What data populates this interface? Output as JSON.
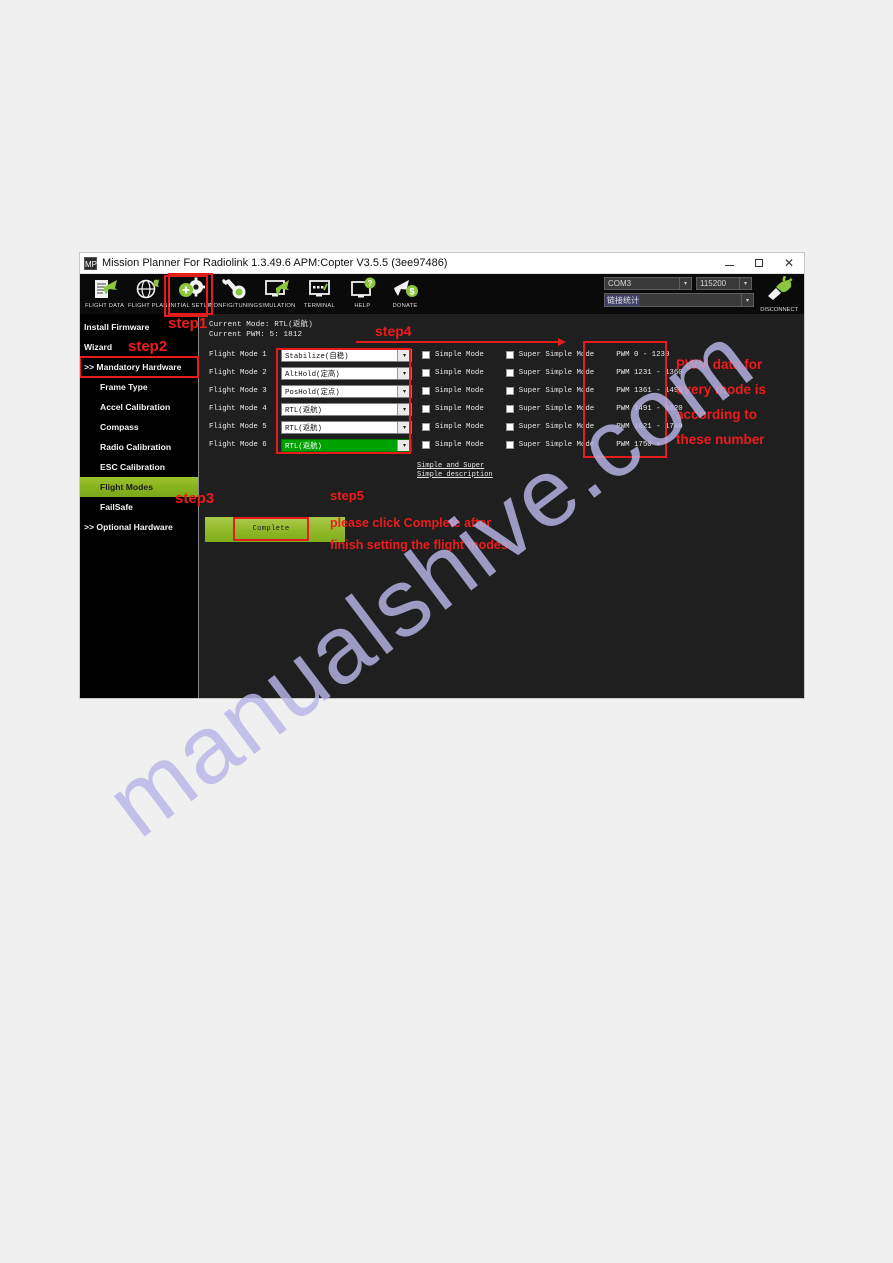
{
  "window": {
    "title": "Mission Planner For Radiolink 1.3.49.6 APM:Copter V3.5.5 (3ee97486)",
    "icon_text": "MP",
    "minimize_label": "–",
    "maximize_label": "❐",
    "close_label": "✕"
  },
  "toolbar": {
    "items": [
      {
        "label": "FLIGHT DATA",
        "icon": "flight-data-icon"
      },
      {
        "label": "FLIGHT PLAN",
        "icon": "flight-plan-icon"
      },
      {
        "label": "INITIAL SETUP",
        "icon": "initial-setup-icon"
      },
      {
        "label": "CONFIG/TUNING",
        "icon": "config-tuning-icon"
      },
      {
        "label": "SIMULATION",
        "icon": "simulation-icon"
      },
      {
        "label": "TERMINAL",
        "icon": "terminal-icon"
      },
      {
        "label": "HELP",
        "icon": "help-icon"
      },
      {
        "label": "DONATE",
        "icon": "donate-icon"
      }
    ],
    "active_index": 2
  },
  "connection": {
    "port": "COM3",
    "baud": "115200",
    "link_label": "链接统计",
    "link_value": "",
    "disconnect_label": "DISCONNECT",
    "dropdown_arrow": "▾"
  },
  "sidebar": {
    "items": [
      {
        "label": "Install Firmware",
        "level": "root",
        "selected": false
      },
      {
        "label": "Wizard",
        "level": "root",
        "selected": false
      },
      {
        "label": ">> Mandatory Hardware",
        "level": "root",
        "selected": false
      },
      {
        "label": "Frame Type",
        "level": "child",
        "selected": false
      },
      {
        "label": "Accel Calibration",
        "level": "child",
        "selected": false
      },
      {
        "label": "Compass",
        "level": "child",
        "selected": false
      },
      {
        "label": "Radio Calibration",
        "level": "child",
        "selected": false
      },
      {
        "label": "ESC Calibration",
        "level": "child",
        "selected": false
      },
      {
        "label": "Flight Modes",
        "level": "child",
        "selected": true
      },
      {
        "label": "FailSafe",
        "level": "child",
        "selected": false
      },
      {
        "label": ">> Optional Hardware",
        "level": "root",
        "selected": false
      }
    ]
  },
  "main": {
    "current_mode_line": "Current Mode: RTL(返航)",
    "current_pwm_line": "Current PWM: 5: 1812",
    "simple_mode_label": "Simple Mode",
    "super_simple_mode_label": "Super Simple Mode",
    "description_link_line1": "Simple and Super",
    "description_link_line2": "Simple description",
    "complete_label": "Complete",
    "dropdown_arrow": "▾",
    "flight_modes": [
      {
        "label": "Flight Mode 1",
        "mode": "Stabilize(自稳)",
        "active": false,
        "simple": false,
        "super_simple": false,
        "pwm": "PWM 0 - 1230"
      },
      {
        "label": "Flight Mode 2",
        "mode": "AltHold(定高)",
        "active": false,
        "simple": false,
        "super_simple": false,
        "pwm": "PWM 1231 - 1360"
      },
      {
        "label": "Flight Mode 3",
        "mode": "PosHold(定点)",
        "active": false,
        "simple": false,
        "super_simple": false,
        "pwm": "PWM 1361 - 1490"
      },
      {
        "label": "Flight Mode 4",
        "mode": "RTL(返航)",
        "active": false,
        "simple": false,
        "super_simple": false,
        "pwm": "PWM 1491 - 1620"
      },
      {
        "label": "Flight Mode 5",
        "mode": "RTL(返航)",
        "active": false,
        "simple": false,
        "super_simple": false,
        "pwm": "PWM 1621 - 1749"
      },
      {
        "label": "Flight Mode 6",
        "mode": "RTL(返航)",
        "active": true,
        "simple": false,
        "super_simple": false,
        "pwm": "PWM 1750 +"
      }
    ]
  },
  "annotations": {
    "step1": "step1",
    "step2": "step2",
    "step3": "step3",
    "step4": "step4",
    "step5": "step5",
    "pwm_note_line1": "PWM data for",
    "pwm_note_line2": "every mode is",
    "pwm_note_line3": "according to",
    "pwm_note_line4": "these number",
    "complete_note_line1": "please click Complete after",
    "complete_note_line2": "finish setting the flight modes",
    "accent_color": "#ee1b1b"
  },
  "watermark": {
    "text": "manualshive.com"
  }
}
